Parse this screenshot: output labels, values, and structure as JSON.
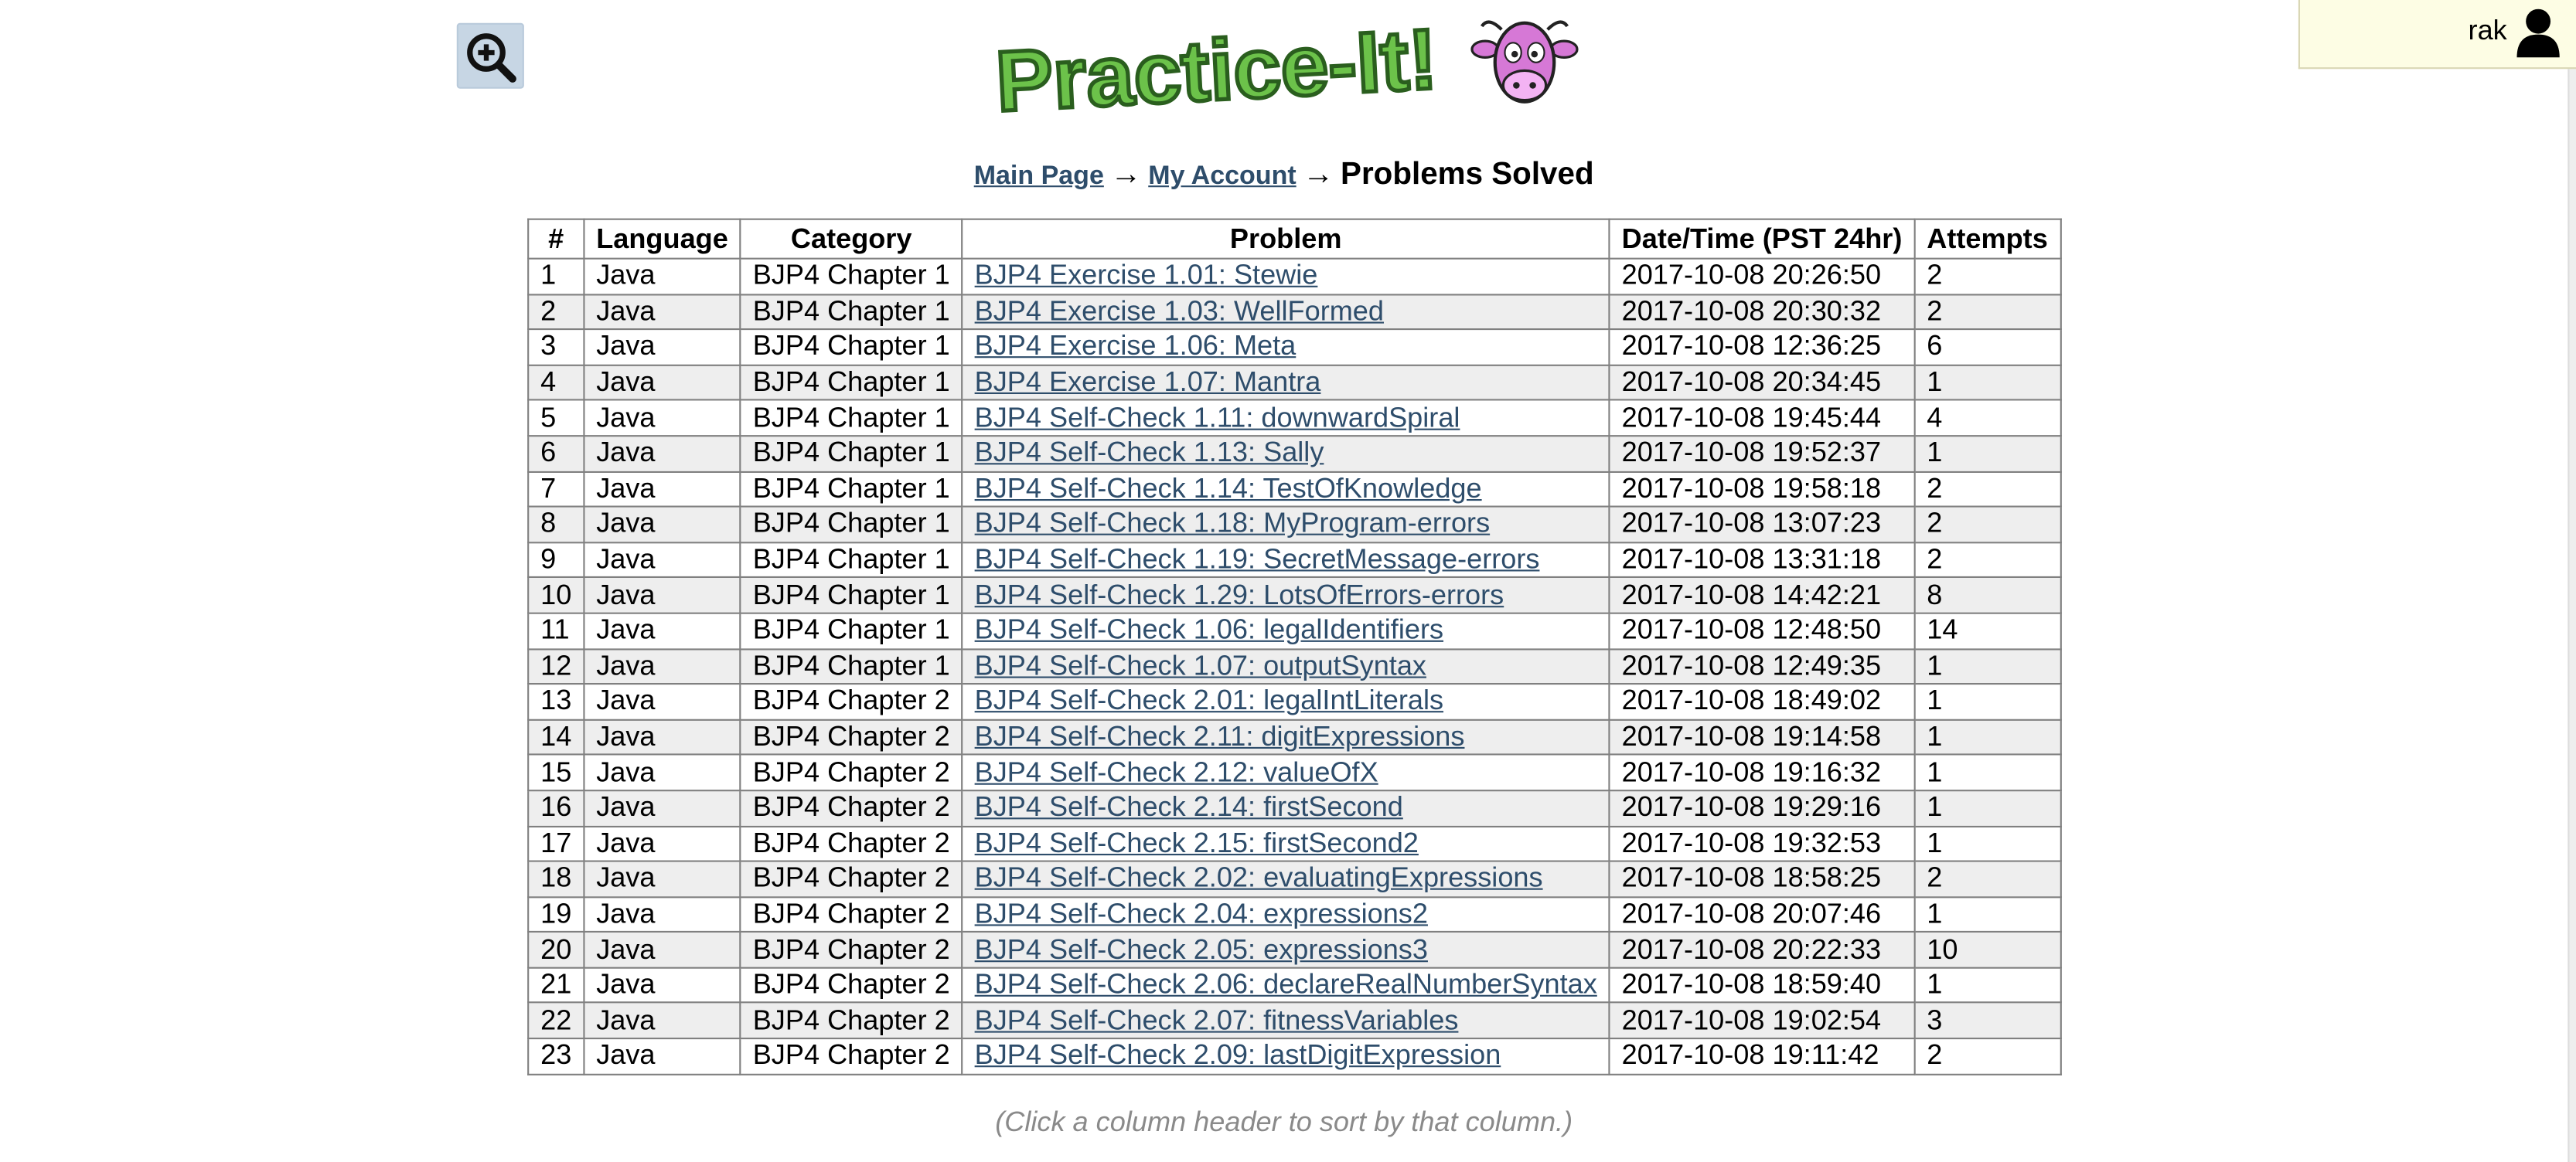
{
  "header": {
    "logo_text": "Practice-It!",
    "user_name": "rak"
  },
  "breadcrumb": {
    "main_page": "Main Page",
    "my_account": "My Account",
    "current": "Problems Solved",
    "separator": "→"
  },
  "table": {
    "columns": [
      "#",
      "Language",
      "Category",
      "Problem",
      "Date/Time (PST 24hr)",
      "Attempts"
    ],
    "rows": [
      [
        "1",
        "Java",
        "BJP4 Chapter 1",
        "BJP4 Exercise 1.01: Stewie",
        "2017-10-08 20:26:50",
        "2"
      ],
      [
        "2",
        "Java",
        "BJP4 Chapter 1",
        "BJP4 Exercise 1.03: WellFormed",
        "2017-10-08 20:30:32",
        "2"
      ],
      [
        "3",
        "Java",
        "BJP4 Chapter 1",
        "BJP4 Exercise 1.06: Meta",
        "2017-10-08 12:36:25",
        "6"
      ],
      [
        "4",
        "Java",
        "BJP4 Chapter 1",
        "BJP4 Exercise 1.07: Mantra",
        "2017-10-08 20:34:45",
        "1"
      ],
      [
        "5",
        "Java",
        "BJP4 Chapter 1",
        "BJP4 Self-Check 1.11: downwardSpiral",
        "2017-10-08 19:45:44",
        "4"
      ],
      [
        "6",
        "Java",
        "BJP4 Chapter 1",
        "BJP4 Self-Check 1.13: Sally",
        "2017-10-08 19:52:37",
        "1"
      ],
      [
        "7",
        "Java",
        "BJP4 Chapter 1",
        "BJP4 Self-Check 1.14: TestOfKnowledge",
        "2017-10-08 19:58:18",
        "2"
      ],
      [
        "8",
        "Java",
        "BJP4 Chapter 1",
        "BJP4 Self-Check 1.18: MyProgram-errors",
        "2017-10-08 13:07:23",
        "2"
      ],
      [
        "9",
        "Java",
        "BJP4 Chapter 1",
        "BJP4 Self-Check 1.19: SecretMessage-errors",
        "2017-10-08 13:31:18",
        "2"
      ],
      [
        "10",
        "Java",
        "BJP4 Chapter 1",
        "BJP4 Self-Check 1.29: LotsOfErrors-errors",
        "2017-10-08 14:42:21",
        "8"
      ],
      [
        "11",
        "Java",
        "BJP4 Chapter 1",
        "BJP4 Self-Check 1.06: legalIdentifiers",
        "2017-10-08 12:48:50",
        "14"
      ],
      [
        "12",
        "Java",
        "BJP4 Chapter 1",
        "BJP4 Self-Check 1.07: outputSyntax",
        "2017-10-08 12:49:35",
        "1"
      ],
      [
        "13",
        "Java",
        "BJP4 Chapter 2",
        "BJP4 Self-Check 2.01: legalIntLiterals",
        "2017-10-08 18:49:02",
        "1"
      ],
      [
        "14",
        "Java",
        "BJP4 Chapter 2",
        "BJP4 Self-Check 2.11: digitExpressions",
        "2017-10-08 19:14:58",
        "1"
      ],
      [
        "15",
        "Java",
        "BJP4 Chapter 2",
        "BJP4 Self-Check 2.12: valueOfX",
        "2017-10-08 19:16:32",
        "1"
      ],
      [
        "16",
        "Java",
        "BJP4 Chapter 2",
        "BJP4 Self-Check 2.14: firstSecond",
        "2017-10-08 19:29:16",
        "1"
      ],
      [
        "17",
        "Java",
        "BJP4 Chapter 2",
        "BJP4 Self-Check 2.15: firstSecond2",
        "2017-10-08 19:32:53",
        "1"
      ],
      [
        "18",
        "Java",
        "BJP4 Chapter 2",
        "BJP4 Self-Check 2.02: evaluatingExpressions",
        "2017-10-08 18:58:25",
        "2"
      ],
      [
        "19",
        "Java",
        "BJP4 Chapter 2",
        "BJP4 Self-Check 2.04: expressions2",
        "2017-10-08 20:07:46",
        "1"
      ],
      [
        "20",
        "Java",
        "BJP4 Chapter 2",
        "BJP4 Self-Check 2.05: expressions3",
        "2017-10-08 20:22:33",
        "10"
      ],
      [
        "21",
        "Java",
        "BJP4 Chapter 2",
        "BJP4 Self-Check 2.06: declareRealNumberSyntax",
        "2017-10-08 18:59:40",
        "1"
      ],
      [
        "22",
        "Java",
        "BJP4 Chapter 2",
        "BJP4 Self-Check 2.07: fitnessVariables",
        "2017-10-08 19:02:54",
        "3"
      ],
      [
        "23",
        "Java",
        "BJP4 Chapter 2",
        "BJP4 Self-Check 2.09: lastDigitExpression",
        "2017-10-08 19:11:42",
        "2"
      ]
    ]
  },
  "hint": "(Click a column header to sort by that column.)",
  "icons": {
    "zoom": "zoom-in-icon",
    "user": "user-icon",
    "logo_mascot": "cow-mascot-icon"
  },
  "colors": {
    "link": "#2e4d6b",
    "row_alt": "#eeeeee",
    "user_box_bg": "#fdfde4",
    "zoom_bg": "#c7d6e4",
    "logo_green": "#6cc24a",
    "mascot_pink": "#d678d6"
  }
}
